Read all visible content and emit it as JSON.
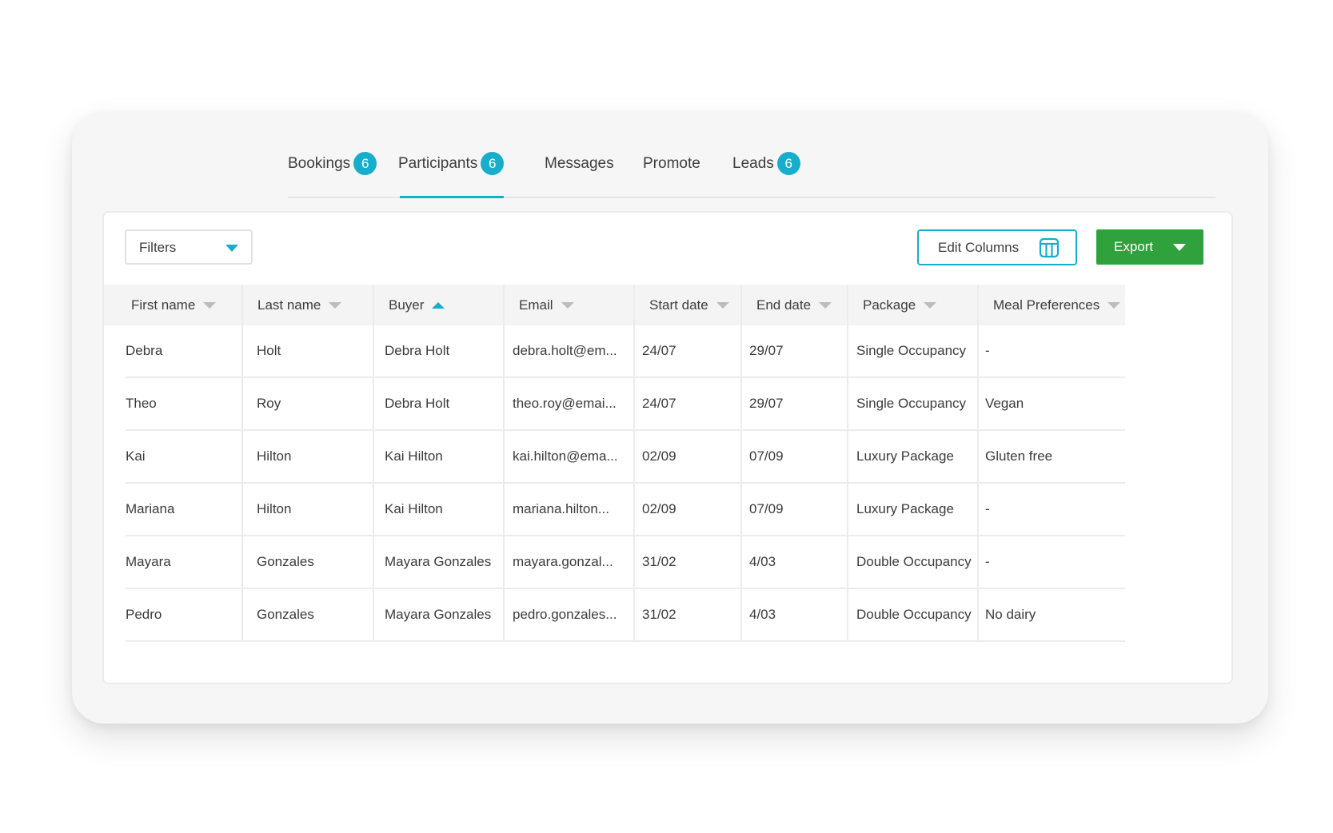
{
  "tabs": [
    {
      "label": "Bookings",
      "badge": "6"
    },
    {
      "label": "Participants",
      "badge": "6"
    },
    {
      "label": "Messages"
    },
    {
      "label": "Promote"
    },
    {
      "label": "Leads",
      "badge": "6"
    }
  ],
  "active_tab": "Participants",
  "toolbar": {
    "filters_label": "Filters",
    "edit_columns_label": "Edit Columns",
    "export_label": "Export"
  },
  "table": {
    "columns": [
      {
        "label": "First name",
        "sort": "none"
      },
      {
        "label": "Last name",
        "sort": "none"
      },
      {
        "label": "Buyer",
        "sort": "ascending"
      },
      {
        "label": "Email",
        "sort": "none"
      },
      {
        "label": "Start date",
        "sort": "none"
      },
      {
        "label": "End date",
        "sort": "none"
      },
      {
        "label": "Package",
        "sort": "none"
      },
      {
        "label": "Meal Preferences",
        "sort": "none"
      }
    ],
    "rows": [
      [
        "Debra",
        "Holt",
        "Debra Holt",
        "debra.holt@em...",
        "24/07",
        "29/07",
        "Single Occupancy",
        "-"
      ],
      [
        "Theo",
        "Roy",
        "Debra Holt",
        "theo.roy@emai...",
        "24/07",
        "29/07",
        "Single Occupancy",
        "Vegan"
      ],
      [
        "Kai",
        "Hilton",
        "Kai Hilton",
        "kai.hilton@ema...",
        "02/09",
        "07/09",
        "Luxury Package",
        "Gluten free"
      ],
      [
        "Mariana",
        "Hilton",
        "Kai Hilton",
        "mariana.hilton...",
        "02/09",
        "07/09",
        "Luxury Package",
        "-"
      ],
      [
        "Mayara",
        "Gonzales",
        "Mayara Gonzales",
        "mayara.gonzal...",
        "31/02",
        "4/03",
        "Double Occupancy",
        "-"
      ],
      [
        "Pedro",
        "Gonzales",
        "Mayara Gonzales",
        "pedro.gonzales...",
        "31/02",
        "4/03",
        "Double Occupancy",
        "No dairy"
      ]
    ]
  },
  "colors": {
    "accent": "#17aecb",
    "export_button": "#2fa23d",
    "card_background": "#f6f6f6"
  },
  "icons": {
    "edit_columns": "table-columns-icon",
    "filters_caret": "chevron-down-icon",
    "export_caret": "chevron-down-icon"
  }
}
